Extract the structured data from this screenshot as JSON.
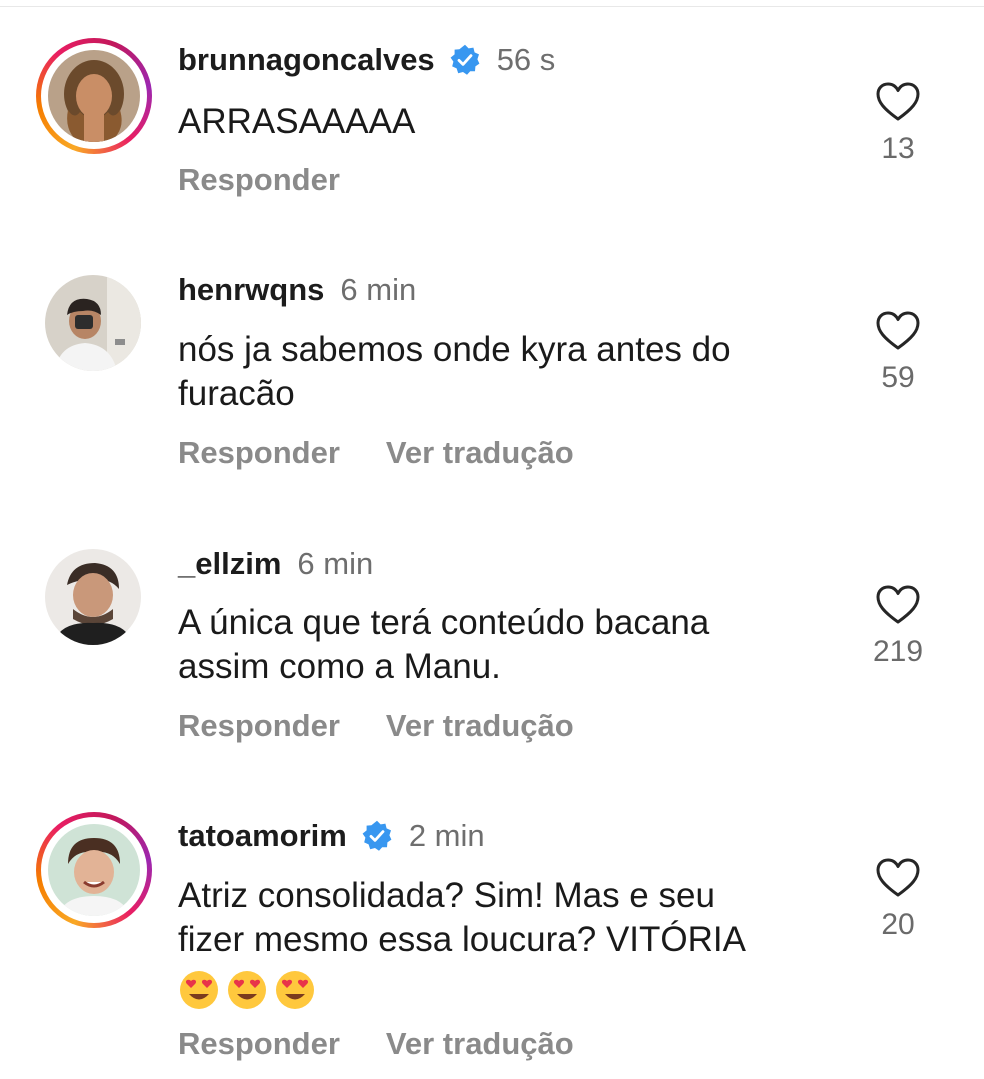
{
  "colors": {
    "verified_badge": "#3897f0",
    "username": "#1c1c1c",
    "meta_text": "#6e6e6e",
    "action_text": "#8a8a8a",
    "story_ring_from": "#f9a825",
    "story_ring_to": "#c2185b"
  },
  "comments": [
    {
      "username": "brunnagoncalves",
      "verified": true,
      "has_story_ring": true,
      "time": "56 s",
      "text": "ARRASAAAAA",
      "actions": [
        "Responder"
      ],
      "likes": "13",
      "icons": [
        "avatar",
        "verified-badge-icon",
        "heart-icon"
      ]
    },
    {
      "username": "henrwqns",
      "verified": false,
      "has_story_ring": false,
      "time": "6 min",
      "text_lines": [
        "nós ja sabemos onde kyra antes do",
        "furacão"
      ],
      "actions": [
        "Responder",
        "Ver tradução"
      ],
      "likes": "59",
      "icons": [
        "avatar",
        "heart-icon"
      ]
    },
    {
      "username": "_ellzim",
      "verified": false,
      "has_story_ring": false,
      "time": "6 min",
      "text_lines": [
        "A única que terá conteúdo bacana",
        "assim como a Manu."
      ],
      "actions": [
        "Responder",
        "Ver tradução"
      ],
      "likes": "219",
      "icons": [
        "avatar",
        "heart-icon"
      ]
    },
    {
      "username": "tatoamorim",
      "verified": true,
      "has_story_ring": true,
      "time": "2 min",
      "text_lines": [
        "Atriz consolidada? Sim! Mas e seu",
        "fizer mesmo essa loucura? VITÓRIA"
      ],
      "emojis": [
        "heart-eyes-emoji",
        "heart-eyes-emoji",
        "heart-eyes-emoji"
      ],
      "actions": [
        "Responder",
        "Ver tradução"
      ],
      "likes": "20",
      "icons": [
        "avatar",
        "verified-badge-icon",
        "heart-icon"
      ]
    }
  ]
}
